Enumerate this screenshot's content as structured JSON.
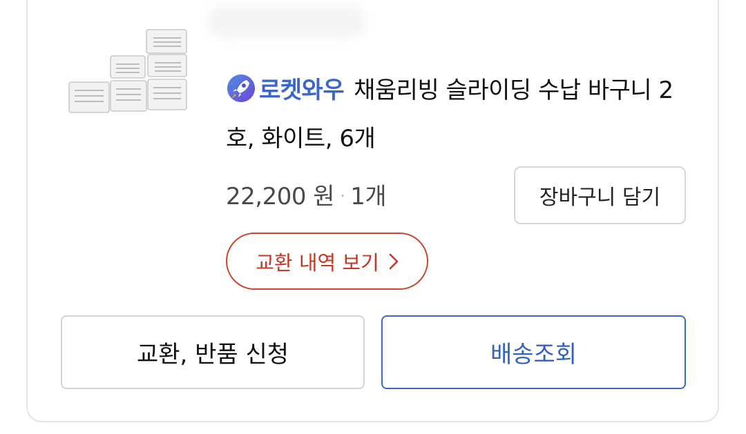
{
  "product": {
    "badge_icon": "rocket-icon",
    "badge_label": "로켓와우",
    "name": "채움리빙 슬라이딩 수납 바구니 2호, 화이트, 6개",
    "price": "22,200 원",
    "separator": "·",
    "quantity": "1개"
  },
  "actions": {
    "add_to_cart": "장바구니 담기",
    "exchange_history": "교환 내역 보기",
    "exchange_return": "교환, 반품 신청",
    "track_delivery": "배송조회"
  },
  "colors": {
    "brand_blue": "#3a66c9",
    "exchange_red": "#c9472c",
    "border_gray": "#d4d4d4"
  }
}
